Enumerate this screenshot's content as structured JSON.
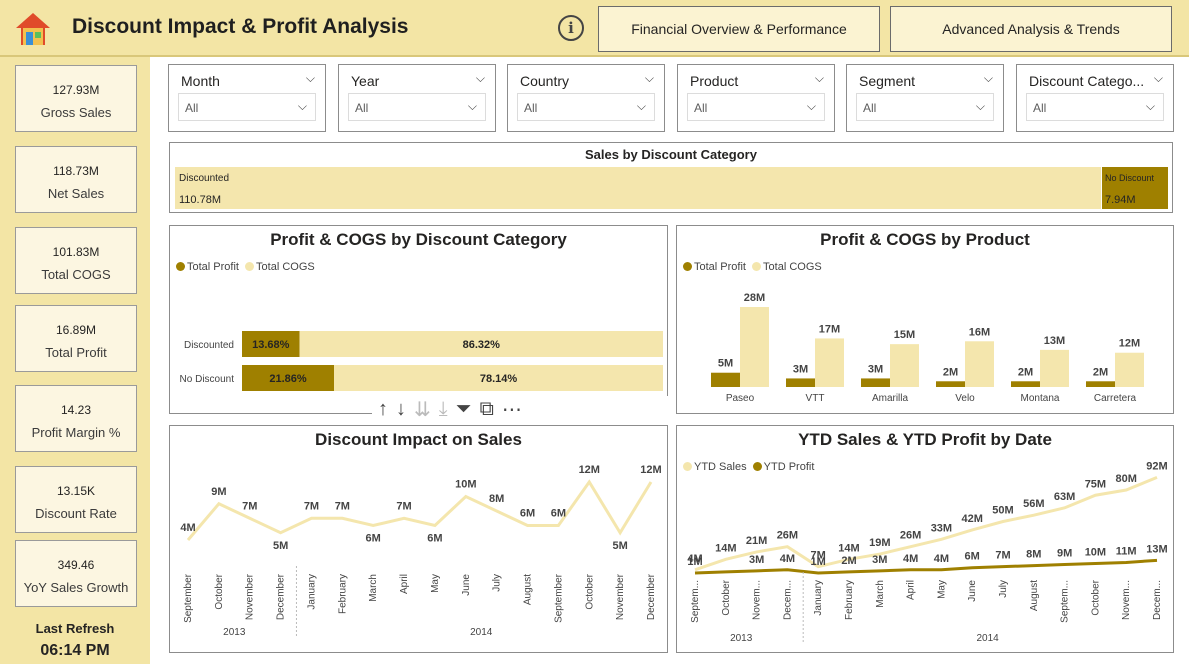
{
  "header": {
    "title": "Discount Impact & Profit Analysis",
    "nav": [
      "Financial Overview & Performance",
      "Advanced Analysis & Trends"
    ],
    "info_glyph": "i"
  },
  "kpis": [
    {
      "value": "127.93M",
      "label": "Gross Sales"
    },
    {
      "value": "118.73M",
      "label": "Net Sales"
    },
    {
      "value": "101.83M",
      "label": "Total COGS"
    },
    {
      "value": "16.89M",
      "label": "Total Profit"
    },
    {
      "value": "14.23",
      "label": "Profit Margin %"
    },
    {
      "value": "13.15K",
      "label": "Discount Rate"
    },
    {
      "value": "349.46",
      "label": "YoY Sales Growth"
    }
  ],
  "refresh": {
    "label": "Last Refresh",
    "time": "06:14 PM"
  },
  "slicers": [
    {
      "title": "Month",
      "value": "All"
    },
    {
      "title": "Year",
      "value": "All"
    },
    {
      "title": "Country",
      "value": "All"
    },
    {
      "title": "Product",
      "value": "All"
    },
    {
      "title": "Segment",
      "value": "All"
    },
    {
      "title": "Discount Catego...",
      "value": "All"
    }
  ],
  "colors": {
    "dark": "#9f8000",
    "light": "#f4e6ad",
    "header_bg": "#f3e5a5"
  },
  "icons": [
    "house-icon",
    "info-icon",
    "chevron-down-icon",
    "arrow-up-icon",
    "arrow-down-icon",
    "drill-down-icon",
    "expand-hierarchy-icon",
    "filter-icon",
    "focus-mode-icon",
    "more-options-icon"
  ],
  "toolbar": {
    "up": "↑",
    "down": "↓",
    "drill": "⇊",
    "expand": "⤓",
    "filter": "⏷",
    "focus": "⧉",
    "more": "⋯"
  },
  "chart_data": [
    {
      "id": "sales_by_discount",
      "type": "bar",
      "title": "Sales by Discount Category",
      "categories": [
        "Discounted",
        "No Discount"
      ],
      "values": [
        110.78,
        7.94
      ],
      "labels": [
        "110.78M",
        "7.94M"
      ]
    },
    {
      "id": "profit_cogs_by_discount",
      "type": "bar",
      "title": "Profit & COGS by Discount Category",
      "categories": [
        "Discounted",
        "No Discount"
      ],
      "series": [
        {
          "name": "Total Profit",
          "values": [
            13.68,
            21.86
          ],
          "labels": [
            "13.68%",
            "21.86%"
          ]
        },
        {
          "name": "Total COGS",
          "values": [
            86.32,
            78.14
          ],
          "labels": [
            "86.32%",
            "78.14%"
          ]
        }
      ],
      "legend": "top-left"
    },
    {
      "id": "profit_cogs_by_product",
      "type": "bar",
      "title": "Profit & COGS by Product",
      "categories": [
        "Paseo",
        "VTT",
        "Amarilla",
        "Velo",
        "Montana",
        "Carretera"
      ],
      "series": [
        {
          "name": "Total Profit",
          "values": [
            5,
            3,
            3,
            2,
            2,
            2
          ],
          "labels": [
            "5M",
            "3M",
            "3M",
            "2M",
            "2M",
            "2M"
          ]
        },
        {
          "name": "Total COGS",
          "values": [
            28,
            17,
            15,
            16,
            13,
            12
          ],
          "labels": [
            "28M",
            "17M",
            "15M",
            "16M",
            "13M",
            "12M"
          ]
        }
      ],
      "legend": "top-left"
    },
    {
      "id": "discount_impact_on_sales",
      "type": "line",
      "title": "Discount Impact on Sales",
      "x": [
        "September",
        "October",
        "November",
        "December",
        "January",
        "February",
        "March",
        "April",
        "May",
        "June",
        "July",
        "August",
        "September",
        "October",
        "November",
        "December"
      ],
      "groups": [
        {
          "label": "2013",
          "count": 4
        },
        {
          "label": "2014",
          "count": 12
        }
      ],
      "values": [
        4,
        9,
        7,
        5,
        7,
        7,
        6,
        7,
        6,
        10,
        8,
        6,
        6,
        12,
        5,
        12
      ],
      "labels": [
        "4M",
        "9M",
        "7M",
        "5M",
        "7M",
        "7M",
        "6M",
        "7M",
        "6M",
        "10M",
        "8M",
        "6M",
        "6M",
        "12M",
        "5M",
        "12M"
      ]
    },
    {
      "id": "ytd_sales_profit",
      "type": "line",
      "title": "YTD Sales & YTD Profit by Date",
      "x": [
        "Septem...",
        "October",
        "Novem...",
        "Decem...",
        "January",
        "February",
        "March",
        "April",
        "May",
        "June",
        "July",
        "August",
        "Septem...",
        "October",
        "Novem...",
        "Decem..."
      ],
      "groups": [
        {
          "label": "2013",
          "count": 4
        },
        {
          "label": "2014",
          "count": 12
        }
      ],
      "series": [
        {
          "name": "YTD Sales",
          "values": [
            4,
            14,
            21,
            26,
            7,
            14,
            19,
            26,
            33,
            42,
            50,
            56,
            63,
            75,
            80,
            92
          ],
          "labels": [
            "4M",
            "14M",
            "21M",
            "26M",
            "7M",
            "14M",
            "19M",
            "26M",
            "33M",
            "42M",
            "50M",
            "56M",
            "63M",
            "75M",
            "80M",
            "92M"
          ]
        },
        {
          "name": "YTD Profit",
          "values": [
            1,
            2,
            3,
            4,
            1,
            2,
            3,
            4,
            4,
            6,
            7,
            8,
            9,
            10,
            11,
            13
          ],
          "labels": [
            "1M",
            "",
            "3M",
            "4M",
            "1M",
            "2M",
            "3M",
            "4M",
            "4M",
            "6M",
            "7M",
            "8M",
            "9M",
            "10M",
            "11M",
            "13M"
          ]
        }
      ],
      "legend": "top-left"
    }
  ]
}
